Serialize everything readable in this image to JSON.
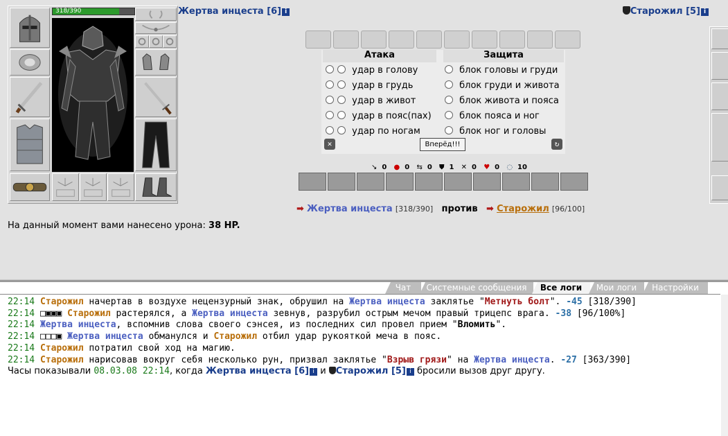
{
  "self": {
    "name": "Жертва инцеста",
    "level": "[6]",
    "hp": "318/390",
    "hp_fraction": 0.815
  },
  "opponent": {
    "name": "Старожил",
    "level": "[5]"
  },
  "attack": {
    "header": "Атака",
    "options": [
      "удар в голову",
      "удар в грудь",
      "удар в живот",
      "удар в пояс(пах)",
      "удар по ногам"
    ]
  },
  "defense": {
    "header": "Защита",
    "options": [
      "блок головы и груди",
      "блок груди и живота",
      "блок живота и пояса",
      "блок пояса и ног",
      "блок ног и головы"
    ]
  },
  "forward_button": "Вперёд!!!",
  "stats": [
    "0",
    "0",
    "0",
    "1",
    "0",
    "0",
    "10"
  ],
  "vs": {
    "self_name": "Жертва инцеста",
    "self_hp": "[318/390]",
    "word": "против",
    "opp_name": "Старожил",
    "opp_hp": "[96/100]"
  },
  "damage": {
    "text": "На данный момент вами нанесено урона:",
    "value": "38 HP."
  },
  "tabs": [
    "Чат",
    "Системные сообщения",
    "Все логи",
    "Мои логи",
    "Настройки"
  ],
  "active_tab": "Все логи",
  "log": {
    "l1": {
      "time": "22:14",
      "actor": "Старожил",
      "a": " начертав в воздухе нецензурный знак, обрушил на ",
      "target": "Жертва инцеста",
      "b": " заклятье \"",
      "spell": "Метнуть болт",
      "c": "\". ",
      "dmg": "-45",
      "d": " [318/390]"
    },
    "l2": {
      "time": "22:14",
      "marks": "□▣▣▣",
      "actor": "Старожил",
      "a": " растерялся, а ",
      "target": "Жертва инцеста",
      "b": " зевнув, разрубил острым мечом правый трицепс врага. ",
      "dmg": "-38",
      "d": " [96/100%]"
    },
    "l3": {
      "time": "22:14",
      "actor": "Жертва инцеста",
      "a": ", вспомнив слова своего сэнсея, из последних сил провел прием \"",
      "skill": "Вломить",
      "b": "\"."
    },
    "l4": {
      "time": "22:14",
      "marks": "□□□▣",
      "actor": "Жертва инцеста",
      "a": " обманулся и ",
      "target": "Старожил",
      "b": " отбил удар рукояткой меча в пояс."
    },
    "l5": {
      "time": "22:14",
      "actor": "Старожил",
      "a": " потратил свой ход на магию."
    },
    "l6": {
      "time": "22:14",
      "actor": "Старожил",
      "a": " нарисовав вокруг себя несколько рун, призвал заклятье \"",
      "spell": "Взрыв грязи",
      "b": "\" на ",
      "target": "Жертва инцеста",
      "c": ". ",
      "dmg": "-27",
      "d": " [363/390]"
    },
    "l7": {
      "pre": "Часы показывали ",
      "date": "08.03.08 22:14",
      "mid": ", когда ",
      "p1": "Жертва инцеста [6]",
      "and": " и ",
      "p2": "Старожил [5]",
      "post": " бросили вызов друг другу."
    }
  },
  "colors": {
    "self_name": "#4b5fc0",
    "opp_name": "#b86e0a",
    "spell": "#a01818",
    "time": "#1a7a1a",
    "hp_bar": "#2c9a2c"
  }
}
